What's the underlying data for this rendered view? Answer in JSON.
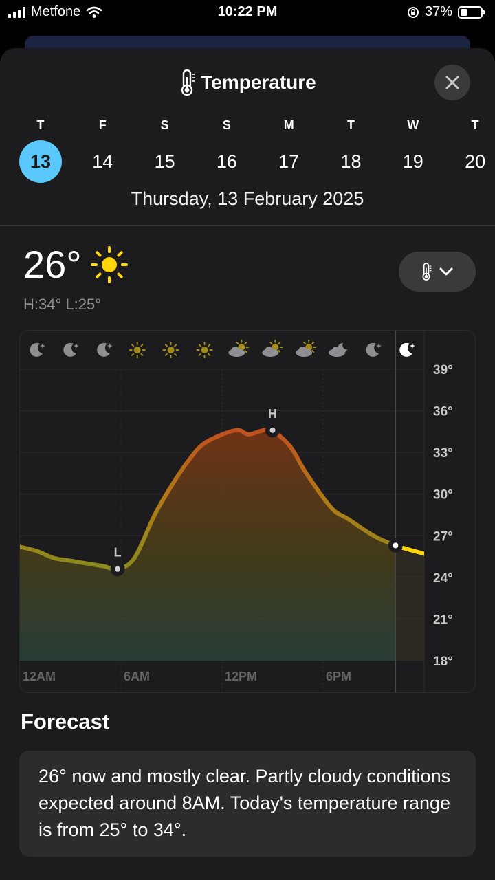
{
  "status_bar": {
    "carrier": "Metfone",
    "time": "10:22 PM",
    "battery": "37%",
    "battery_level": 0.37
  },
  "header": {
    "title": "Temperature",
    "icon": "thermometer-icon",
    "close_icon": "close-icon"
  },
  "days": [
    {
      "letter": "T",
      "number": "13",
      "selected": true
    },
    {
      "letter": "F",
      "number": "14"
    },
    {
      "letter": "S",
      "number": "15"
    },
    {
      "letter": "S",
      "number": "16"
    },
    {
      "letter": "M",
      "number": "17"
    },
    {
      "letter": "T",
      "number": "18"
    },
    {
      "letter": "W",
      "number": "19"
    },
    {
      "letter": "T",
      "number": "20"
    }
  ],
  "selected_date": "Thursday, 13 February 2025",
  "current": {
    "temp": "26°",
    "condition_icon": "sun-icon",
    "hi_lo": "H:34° L:25°"
  },
  "picker": {
    "icon": "thermometer-icon",
    "chevron": "chevron-down-icon"
  },
  "chart_data": {
    "type": "area",
    "hour_icons": [
      "moon-icon",
      "moon-icon",
      "moon-icon",
      "sun-icon",
      "sun-icon",
      "sun-icon",
      "partly-cloudy-icon",
      "partly-cloudy-icon",
      "partly-cloudy-icon",
      "cloudy-night-icon",
      "moon-icon",
      "moon-icon"
    ],
    "x_labels": [
      {
        "text": "12AM",
        "hour": 0
      },
      {
        "text": "6AM",
        "hour": 6
      },
      {
        "text": "12PM",
        "hour": 12
      },
      {
        "text": "6PM",
        "hour": 18
      }
    ],
    "y_ticks": [
      "39°",
      "36°",
      "33°",
      "30°",
      "27°",
      "24°",
      "21°",
      "18°"
    ],
    "ylim": [
      18,
      39
    ],
    "xlim": [
      0,
      24
    ],
    "now_hour": 22.3,
    "points": [
      [
        0,
        26.2
      ],
      [
        1,
        25.9
      ],
      [
        2,
        25.4
      ],
      [
        3,
        25.2
      ],
      [
        4,
        25.0
      ],
      [
        5,
        24.8
      ],
      [
        5.8,
        24.6
      ],
      [
        6.8,
        25.4
      ],
      [
        8,
        28.5
      ],
      [
        9,
        30.6
      ],
      [
        10,
        32.4
      ],
      [
        11,
        33.7
      ],
      [
        12.8,
        34.6
      ],
      [
        13.6,
        34.3
      ],
      [
        14.8,
        34.6
      ],
      [
        16,
        33.5
      ],
      [
        17,
        31.5
      ],
      [
        18.5,
        29.0
      ],
      [
        19.5,
        28.2
      ],
      [
        21,
        27.0
      ],
      [
        22.3,
        26.3
      ],
      [
        24,
        25.7
      ]
    ],
    "low": {
      "label": "L",
      "hour": 5.8,
      "value": 24.6
    },
    "high": {
      "label": "H",
      "hour": 15.0,
      "value": 34.6
    }
  },
  "forecast": {
    "heading": "Forecast",
    "text": "26° now and mostly clear. Partly cloudy conditions expected around 8AM. Today's temperature range is from 25° to 34°."
  }
}
